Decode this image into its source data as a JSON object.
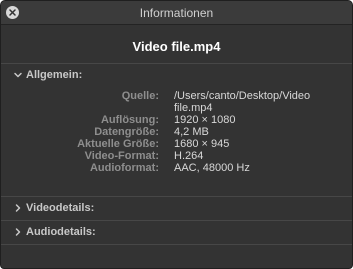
{
  "window": {
    "title": "Informationen"
  },
  "file": {
    "name": "Video file.mp4"
  },
  "general": {
    "label": "Allgemein:",
    "rows": [
      {
        "key": "Quelle:",
        "value": "/Users/canto/Desktop/Video file.mp4"
      },
      {
        "key": "Auflösung:",
        "value": "1920 × 1080"
      },
      {
        "key": "Datengröße:",
        "value": "4,2 MB"
      },
      {
        "key": "Aktuelle Größe:",
        "value": "1680 × 945"
      },
      {
        "key": "Video-Format:",
        "value": "H.264"
      },
      {
        "key": "Audioformat:",
        "value": "AAC, 48000 Hz"
      }
    ]
  },
  "video_details": {
    "label": "Videodetails:"
  },
  "audio_details": {
    "label": "Audiodetails:"
  }
}
